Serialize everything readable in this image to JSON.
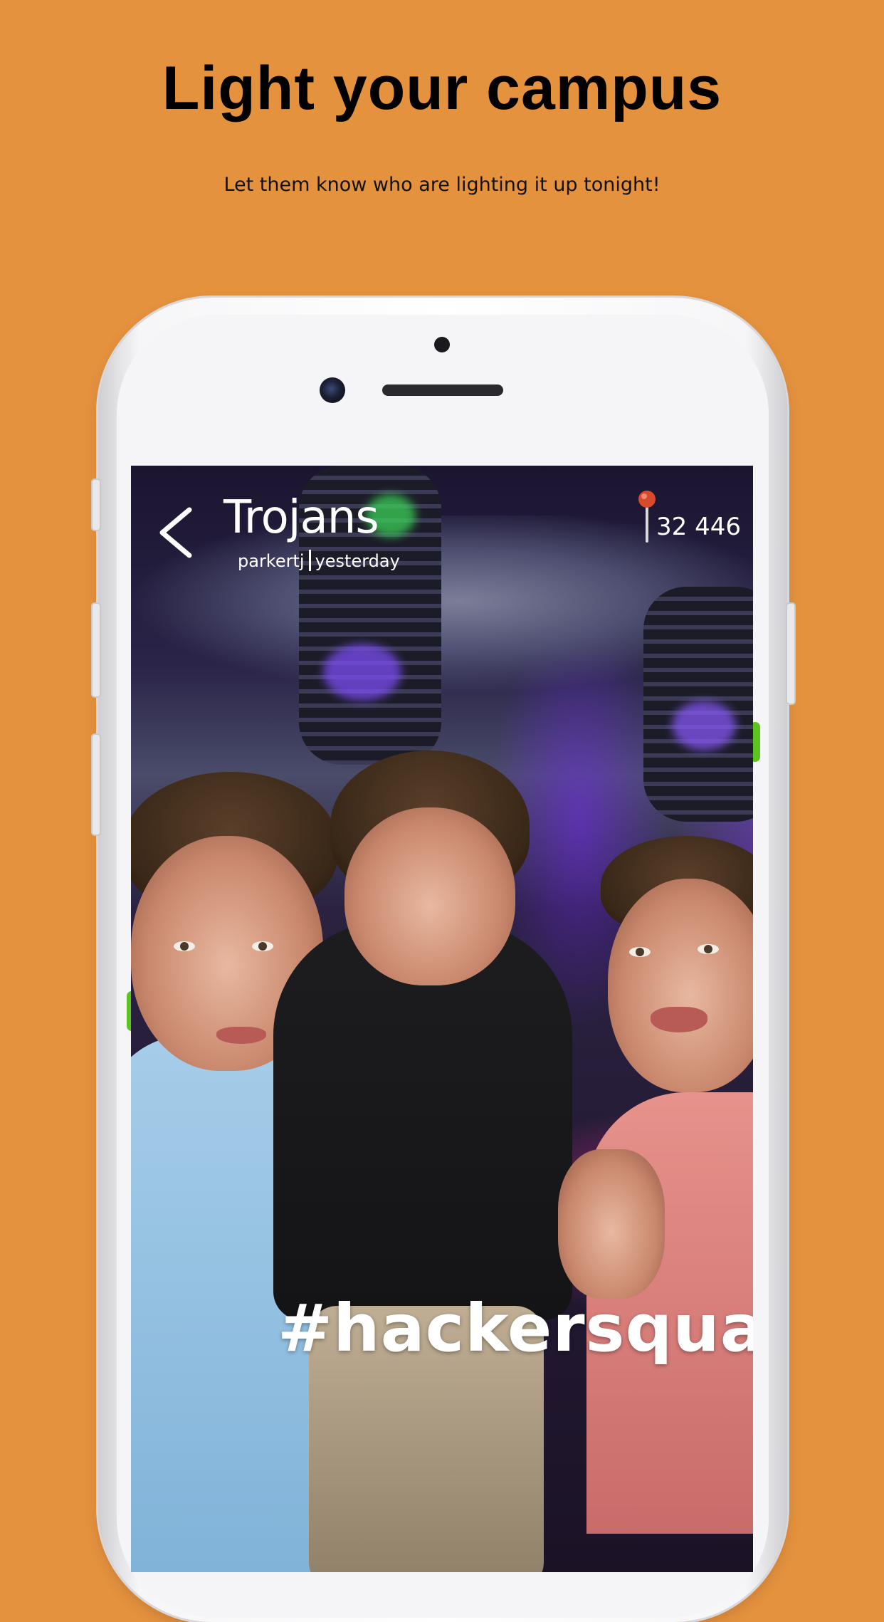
{
  "page": {
    "headline": "Light your campus",
    "subheadline": "Let them know who are lighting it up tonight!",
    "background_color": "#E5923E"
  },
  "story": {
    "title": "Trojans",
    "author": "parkertj",
    "time": "yesterday",
    "view_count": "32 446",
    "caption": "#hackersquad",
    "icons": {
      "back": "chevron-left-icon",
      "location": "map-pin-icon"
    },
    "pin_color": "#D94A2B"
  }
}
